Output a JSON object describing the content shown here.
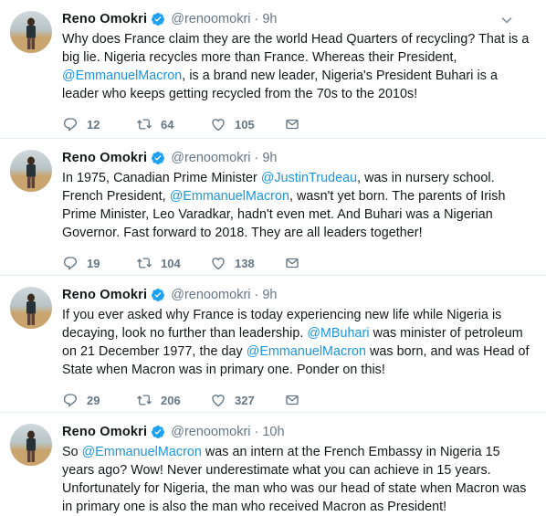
{
  "tweets": [
    {
      "name": "Reno Omokri",
      "handle": "@renoomokri",
      "time": "9h",
      "text": [
        {
          "t": "Why does France claim they are the world Head Quarters of recycling? That is a big lie. Nigeria recycles more than France. Whereas their President, "
        },
        {
          "t": "@EmmanuelMacron",
          "mention": true
        },
        {
          "t": ", is a brand new leader, Nigeria's President Buhari is a leader who keeps getting recycled from the 70s to the 2010s!"
        }
      ],
      "replies": "12",
      "retweets": "64",
      "likes": "105"
    },
    {
      "name": "Reno Omokri",
      "handle": "@renoomokri",
      "time": "9h",
      "text": [
        {
          "t": "In 1975, Canadian Prime Minister "
        },
        {
          "t": "@JustinTrudeau",
          "mention": true
        },
        {
          "t": ", was in nursery school. French President, "
        },
        {
          "t": "@EmmanuelMacron",
          "mention": true
        },
        {
          "t": ", wasn't yet born. The parents of Irish Prime Minister, Leo Varadkar, hadn't even met. And Buhari was a Nigerian Governor. Fast forward to 2018. They are all leaders together!"
        }
      ],
      "replies": "19",
      "retweets": "104",
      "likes": "138"
    },
    {
      "name": "Reno Omokri",
      "handle": "@renoomokri",
      "time": "9h",
      "text": [
        {
          "t": "If you ever asked why France is today experiencing new life while Nigeria is decaying, look no further than leadership. "
        },
        {
          "t": "@MBuhari",
          "mention": true
        },
        {
          "t": " was minister of petroleum on 21 December 1977, the day "
        },
        {
          "t": "@EmmanuelMacron",
          "mention": true
        },
        {
          "t": " was born, and was Head of State when Macron was in primary one. Ponder on this!"
        }
      ],
      "replies": "29",
      "retweets": "206",
      "likes": "327"
    },
    {
      "name": "Reno Omokri",
      "handle": "@renoomokri",
      "time": "10h",
      "text": [
        {
          "t": "So "
        },
        {
          "t": "@EmmanuelMacron",
          "mention": true
        },
        {
          "t": " was an intern at the French Embassy in Nigeria 15 years ago? Wow! Never underestimate what you can achieve in 15 years. Unfortunately for Nigeria, the man who was our head of state when Macron was in primary one is also the man who received Macron as President!"
        }
      ],
      "replies": "",
      "retweets": "",
      "likes": ""
    }
  ],
  "icons": {
    "reply": "reply-icon",
    "retweet": "retweet-icon",
    "like": "heart-icon",
    "dm": "envelope-icon",
    "verified": "verified-badge-icon",
    "caret": "chevron-down-icon"
  },
  "colors": {
    "mention": "#1b95e0",
    "muted": "#657786",
    "verified": "#1da1f2"
  }
}
